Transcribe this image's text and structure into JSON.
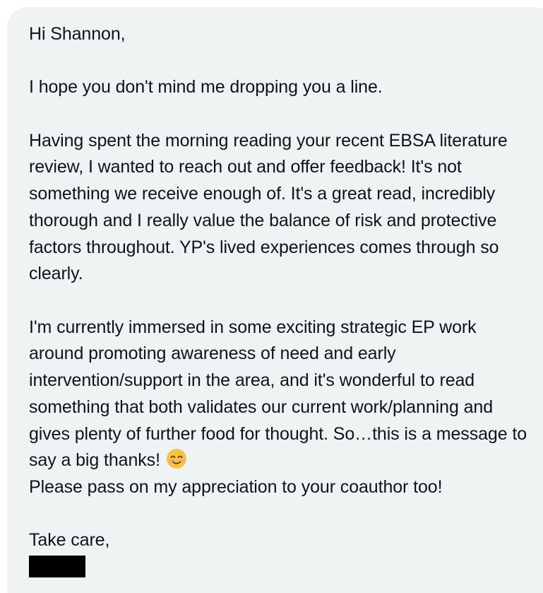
{
  "message": {
    "greeting": "Hi Shannon,",
    "paragraph_1": "I hope you don't mind me dropping you a line.",
    "paragraph_2": "Having spent the morning reading your recent EBSA literature review, I wanted to reach out and offer feedback! It's not something we receive enough of. It's a great read, incredibly thorough and I really value the balance of risk and protective factors throughout. YP's lived experiences comes through so clearly.",
    "paragraph_3_main": "I'm currently immersed in some exciting strategic EP work around promoting awareness of need and early intervention/support in the area, and it's wonderful to read something that both validates our current work/planning and gives plenty of further food for thought. So…this is a message to say a big thanks!",
    "paragraph_3_end": "Please pass on my appreciation to your coauthor too!",
    "closing": "Take care,",
    "emoji_icon": "smiling-face-with-smiling-eyes-icon"
  },
  "colors": {
    "bubble_background": "#eff3f4",
    "text": "#0f1419",
    "redaction": "#000000"
  }
}
